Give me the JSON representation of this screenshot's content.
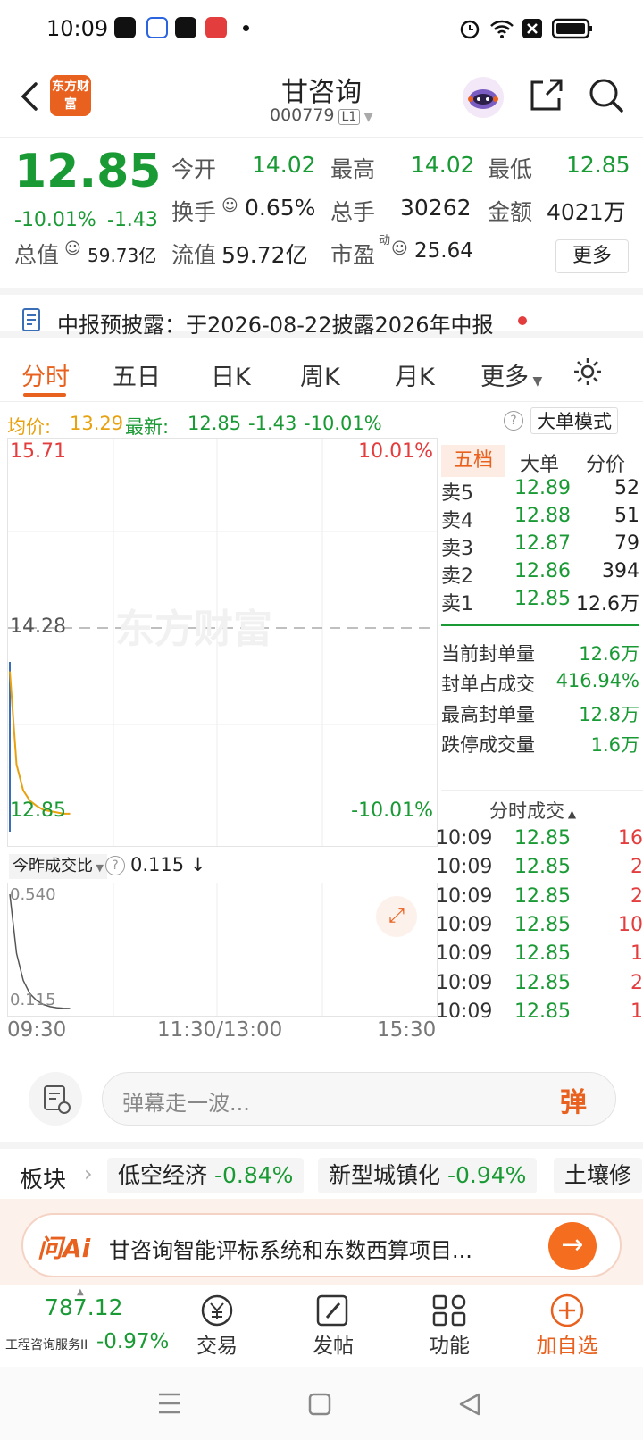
{
  "status_bar": {
    "time": "10:09"
  },
  "header": {
    "title": "甘咨询",
    "code": "000779",
    "level_badge": "L1",
    "logo_text": "东方财富"
  },
  "quote": {
    "price": "12.85",
    "change_pct": "-10.01%",
    "change": "-1.43",
    "open_label": "今开",
    "open": "14.02",
    "high_label": "最高",
    "high": "14.02",
    "low_label": "最低",
    "low": "12.85",
    "turnover_label": "换手",
    "turnover": "0.65%",
    "volume_label": "总手",
    "volume": "30262",
    "amount_label": "金额",
    "amount": "4021万",
    "mktcap_label": "总值",
    "mktcap": "59.73亿",
    "float_label": "流值",
    "float": "59.72亿",
    "pe_label": "市盈",
    "pe_sup": "动",
    "pe": "25.64",
    "more": "更多"
  },
  "notice": {
    "text": "中报预披露：于2026-08-22披露2026年中报"
  },
  "tabs": [
    "分时",
    "五日",
    "日K",
    "周K",
    "月K",
    "更多"
  ],
  "info_bar": {
    "avg_label": "均价:",
    "avg": "13.29",
    "latest_label": "最新:",
    "latest": "12.85",
    "chg": "-1.43",
    "pct": "-10.01%",
    "big_mode": "大单模式"
  },
  "chart_axes": {
    "top_price": "15.71",
    "top_pct": "10.01%",
    "mid_price": "14.28",
    "bottom_price": "12.85",
    "bottom_pct": "-10.01%",
    "watermark": "东方财富",
    "vol_label": "今昨成交比",
    "vol_value": "0.115",
    "vol_top": "0.540",
    "vol_bottom": "0.115",
    "time_start": "09:30",
    "time_mid": "11:30/13:00",
    "time_end": "15:30"
  },
  "chart_data": {
    "type": "line",
    "price_range": [
      12.85,
      15.71
    ],
    "price_series": [
      14.02,
      13.3,
      13.1,
      13.02,
      12.98,
      12.95,
      12.94,
      12.93,
      12.92,
      12.92
    ],
    "volume_ratio_range": [
      0.115,
      0.54
    ],
    "volume_ratio_series": [
      0.54,
      0.32,
      0.22,
      0.17,
      0.145,
      0.13,
      0.122,
      0.118,
      0.116,
      0.115
    ]
  },
  "order_book": {
    "tabs": [
      "五档",
      "大单",
      "分价"
    ],
    "asks": [
      {
        "label": "卖5",
        "price": "12.89",
        "vol": "52"
      },
      {
        "label": "卖4",
        "price": "12.88",
        "vol": "51"
      },
      {
        "label": "卖3",
        "price": "12.87",
        "vol": "79"
      },
      {
        "label": "卖2",
        "price": "12.86",
        "vol": "394"
      },
      {
        "label": "卖1",
        "price": "12.85",
        "vol": "12.6万"
      }
    ],
    "stats": [
      {
        "label": "当前封单量",
        "value": "12.6万"
      },
      {
        "label": "封单占成交",
        "value": "416.94%"
      },
      {
        "label": "最高封单量",
        "value": "12.8万"
      },
      {
        "label": "跌停成交量",
        "value": "1.6万"
      }
    ],
    "ticks_title": "分时成交",
    "ticks": [
      {
        "time": "10:09",
        "price": "12.85",
        "vol": "16"
      },
      {
        "time": "10:09",
        "price": "12.85",
        "vol": "2"
      },
      {
        "time": "10:09",
        "price": "12.85",
        "vol": "2"
      },
      {
        "time": "10:09",
        "price": "12.85",
        "vol": "10"
      },
      {
        "time": "10:09",
        "price": "12.85",
        "vol": "1"
      },
      {
        "time": "10:09",
        "price": "12.85",
        "vol": "2"
      },
      {
        "time": "10:09",
        "price": "12.85",
        "vol": "1"
      }
    ]
  },
  "danmu": {
    "placeholder": "弹幕走一波...",
    "button": "弹"
  },
  "sectors": {
    "label": "板块",
    "items": [
      {
        "name": "低空经济",
        "pct": "-0.84%"
      },
      {
        "name": "新型城镇化",
        "pct": "-0.94%"
      },
      {
        "name": "土壤修",
        "pct": ""
      }
    ]
  },
  "ai": {
    "brand": "问Ai",
    "text": "甘咨询智能评标系统和东数西算项目..."
  },
  "bottom_bar": {
    "index_value": "787.12",
    "index_name": "工程咨询服务II",
    "index_pct": "-0.97%",
    "trade": "交易",
    "post": "发帖",
    "func": "功能",
    "add": "加自选"
  },
  "colors": {
    "green": "#1a9a34",
    "red": "#e33d3d",
    "orange": "#e8611f"
  }
}
